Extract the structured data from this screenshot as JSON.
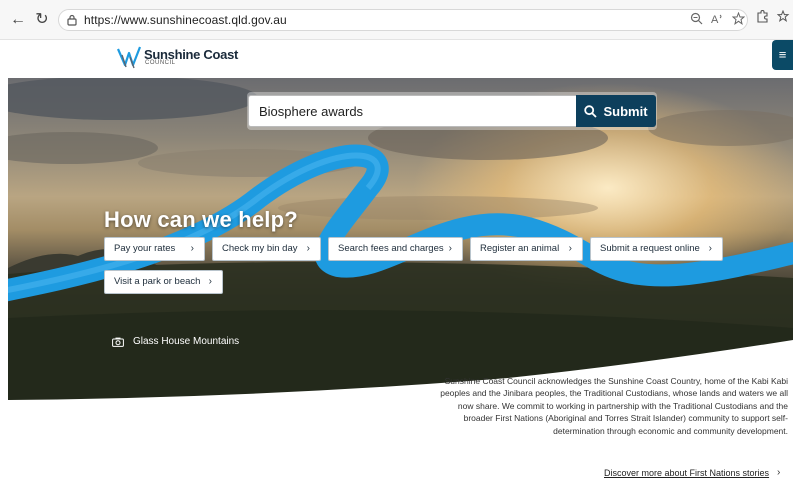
{
  "browser": {
    "url": "https://www.sunshinecoast.qld.gov.au",
    "back_glyph": "←",
    "reload_glyph": "↻",
    "icons": [
      "lock-icon",
      "zoom-icon",
      "read-aloud-icon",
      "favorite-star-icon",
      "extensions-icon",
      "favorites-bar-icon"
    ]
  },
  "header": {
    "logo_name": "Sunshine Coast",
    "logo_sub": "COUNCIL",
    "menu_glyph": "≡"
  },
  "search": {
    "value": "Biosphere awards",
    "submit_label": "Submit"
  },
  "hero": {
    "title": "How can we help?",
    "quick_links": [
      {
        "label": "Pay your rates"
      },
      {
        "label": "Check my bin day"
      },
      {
        "label": "Search fees and charges"
      },
      {
        "label": "Register an animal"
      },
      {
        "label": "Submit a request online"
      },
      {
        "label": "Visit a park or beach"
      }
    ],
    "chevron": "›",
    "caption": "Glass House Mountains"
  },
  "acknowledgement": {
    "text": "Sunshine Coast Council acknowledges the Sunshine Coast Country, home of the Kabi Kabi peoples and the Jinibara peoples, the Traditional Custodians, whose lands and waters we all now share. We commit to working in partnership with the Traditional Custodians and the broader First Nations (Aboriginal and Torres Strait Islander) community to support self-determination through economic and community development.",
    "link_label": "Discover more about First Nations stories",
    "link_chevron": "›"
  },
  "colors": {
    "brand_navy": "#0d3f5c",
    "ribbon_blue": "#1e9be0"
  }
}
